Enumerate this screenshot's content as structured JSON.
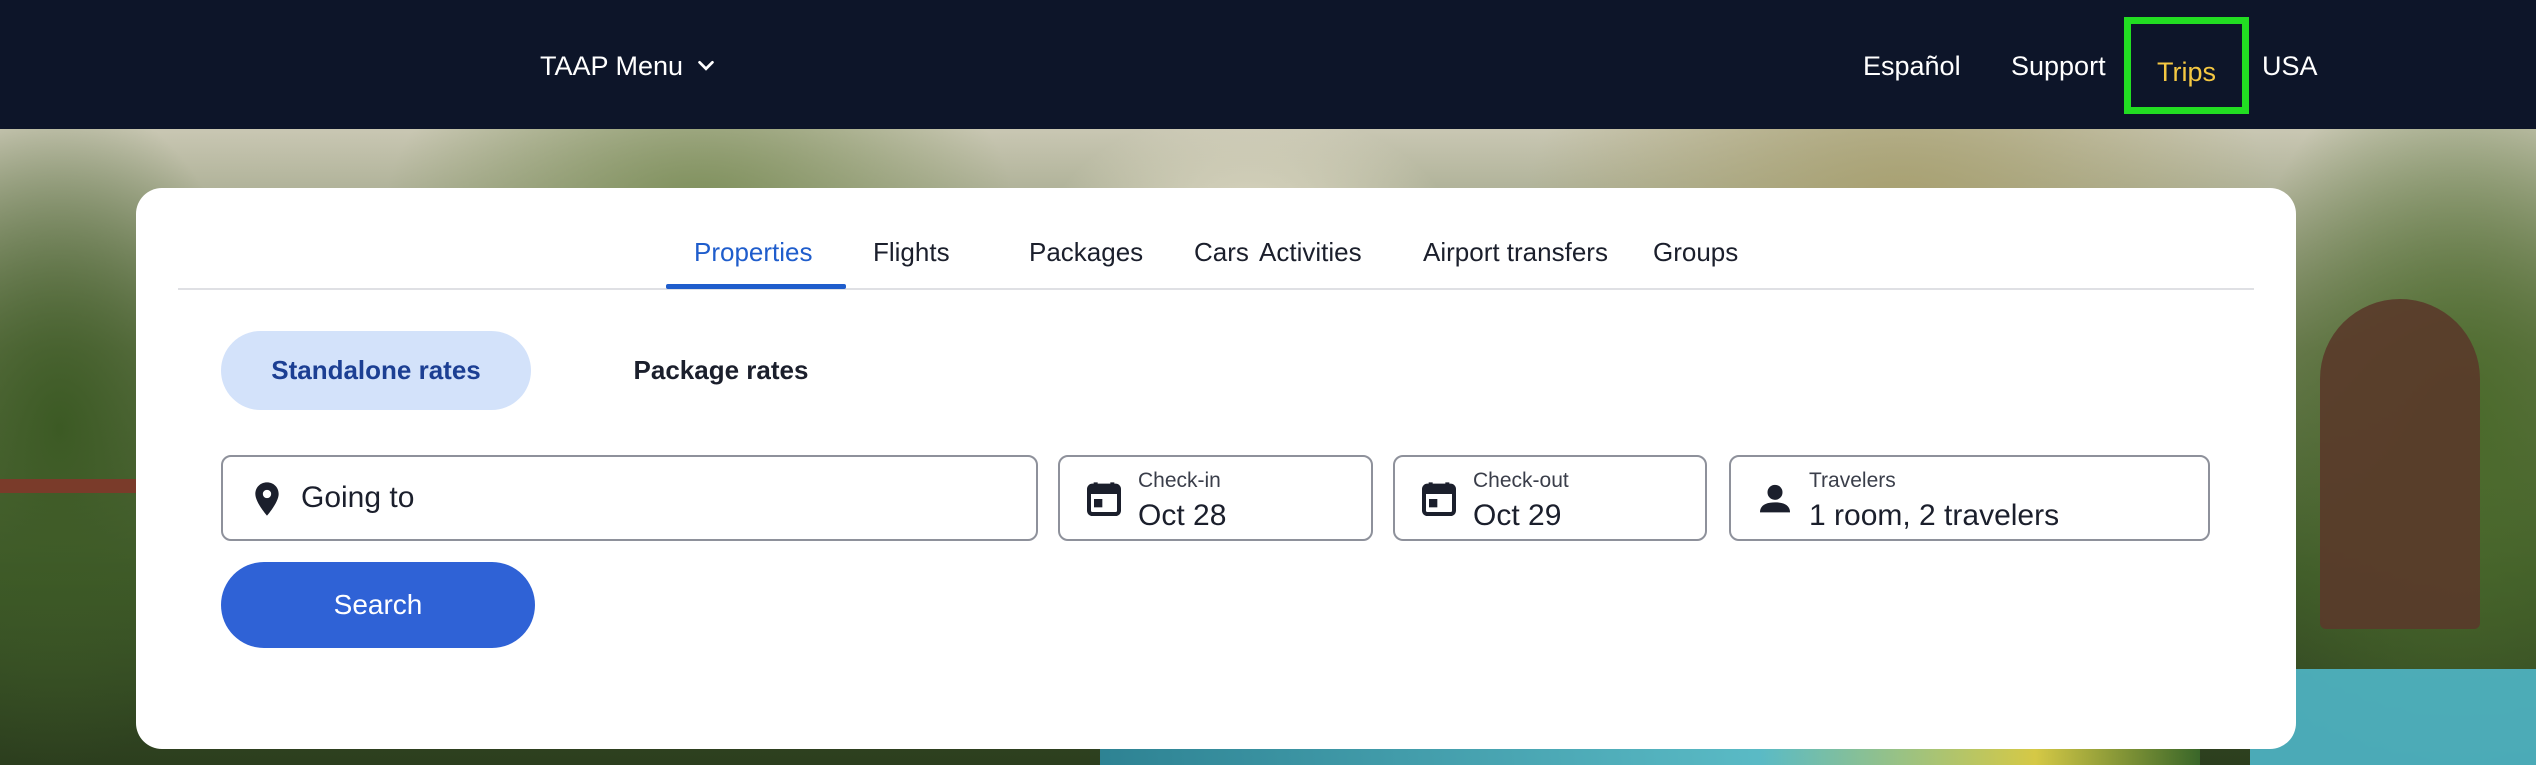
{
  "header": {
    "menu_label": "TAAP Menu",
    "links": {
      "espanol": "Español",
      "support": "Support",
      "trips": "Trips",
      "region": "USA"
    },
    "trips_highlight_color": "#22dd22",
    "trips_text_color": "#f5c842"
  },
  "search_card": {
    "tabs": [
      {
        "label": "Properties",
        "active": true
      },
      {
        "label": "Flights",
        "active": false
      },
      {
        "label": "Packages",
        "active": false
      },
      {
        "label": "Cars",
        "active": false
      },
      {
        "label": "Activities",
        "active": false
      },
      {
        "label": "Airport transfers",
        "active": false
      },
      {
        "label": "Groups",
        "active": false
      }
    ],
    "rate_options": {
      "standalone": "Standalone rates",
      "package": "Package rates",
      "selected": "Standalone rates"
    },
    "going_to": {
      "placeholder": "Going to",
      "icon": "map-pin-icon"
    },
    "check_in": {
      "label": "Check-in",
      "value": "Oct 28",
      "icon": "calendar-icon"
    },
    "check_out": {
      "label": "Check-out",
      "value": "Oct 29",
      "icon": "calendar-icon"
    },
    "travelers": {
      "label": "Travelers",
      "value": "1 room, 2 travelers",
      "icon": "person-icon"
    },
    "search_button": "Search",
    "accent_color": "#1f5dcc"
  }
}
